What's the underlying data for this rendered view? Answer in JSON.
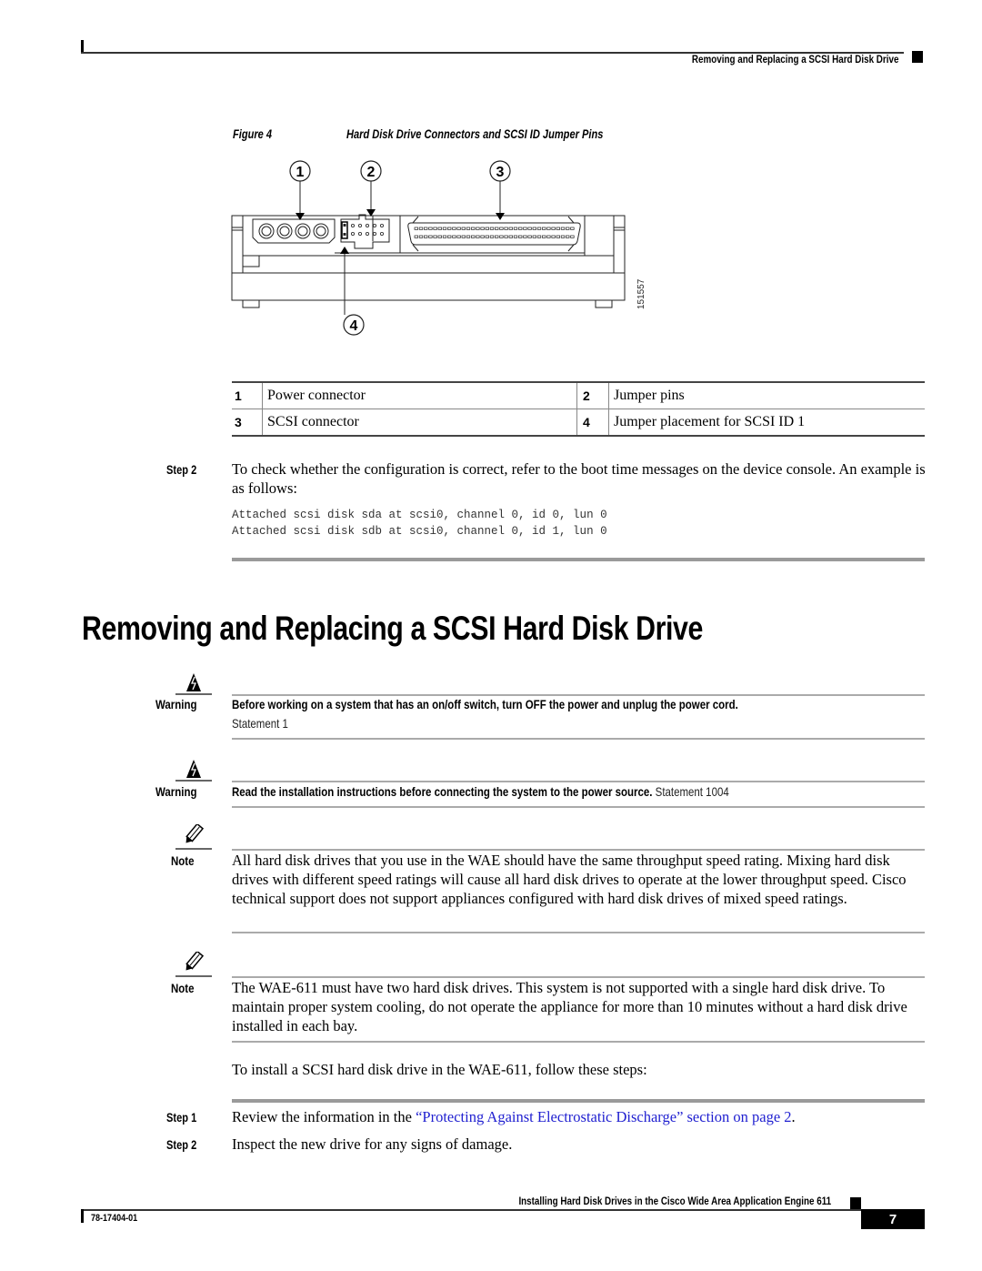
{
  "header": {
    "running_title": "Removing and Replacing a SCSI Hard Disk Drive"
  },
  "figure": {
    "label": "Figure 4",
    "title": "Hard Disk Drive Connectors and SCSI ID Jumper Pins",
    "callouts": [
      "1",
      "2",
      "3",
      "4"
    ],
    "art_id": "151557"
  },
  "legend": {
    "rows": [
      {
        "num_a": "1",
        "desc_a": "Power connector",
        "num_b": "2",
        "desc_b": "Jumper pins"
      },
      {
        "num_a": "3",
        "desc_a": "SCSI connector",
        "num_b": "4",
        "desc_b": "Jumper placement for SCSI ID 1"
      }
    ]
  },
  "step_check": {
    "label": "Step 2",
    "text": "To check whether the configuration is correct, refer to the boot time messages on the device console. An example is as follows:",
    "code": [
      "Attached scsi disk sda at scsi0, channel 0, id 0, lun 0",
      "Attached scsi disk sdb at scsi0, channel 0, id 1, lun 0"
    ]
  },
  "section": {
    "title": "Removing and Replacing a SCSI Hard Disk Drive"
  },
  "warnings": [
    {
      "label": "Warning",
      "icon": "warning-lightning-icon",
      "text": "Before working on a system that has an on/off switch, turn OFF the power and unplug the power cord.",
      "statement": "Statement 1"
    },
    {
      "label": "Warning",
      "icon": "warning-lightning-icon",
      "text": "Read the installation instructions before connecting the system to the power source.",
      "statement": "Statement 1004"
    }
  ],
  "notes": [
    {
      "label": "Note",
      "icon": "pencil-icon",
      "text": "All hard disk drives that you use in the WAE should have the same throughput speed rating. Mixing hard disk drives with different speed ratings will cause all hard disk drives to operate at the lower throughput speed. Cisco technical support does not support appliances configured with hard disk drives of mixed speed ratings."
    },
    {
      "label": "Note",
      "icon": "pencil-icon",
      "text": "The WAE-611 must have two hard disk drives. This system is not supported with a single hard disk drive. To maintain proper system cooling, do not operate the appliance for more than 10 minutes without a hard disk drive installed in each bay."
    }
  ],
  "procedure": {
    "intro": "To install a SCSI hard disk drive in the WAE-611, follow these steps:",
    "steps": [
      {
        "label": "Step 1",
        "text_before": "Review the information in the ",
        "link": "“Protecting Against Electrostatic Discharge” section on page 2",
        "text_after": "."
      },
      {
        "label": "Step 2",
        "text": "Inspect the new drive for any signs of damage."
      }
    ]
  },
  "footer": {
    "book_title": "Installing Hard Disk Drives in the Cisco Wide Area Application Engine 611",
    "doc_number": "78-17404-01",
    "page_number": "7"
  },
  "colors": {
    "link": "#1f1fd0",
    "rule_gray": "#9a9a9a"
  }
}
